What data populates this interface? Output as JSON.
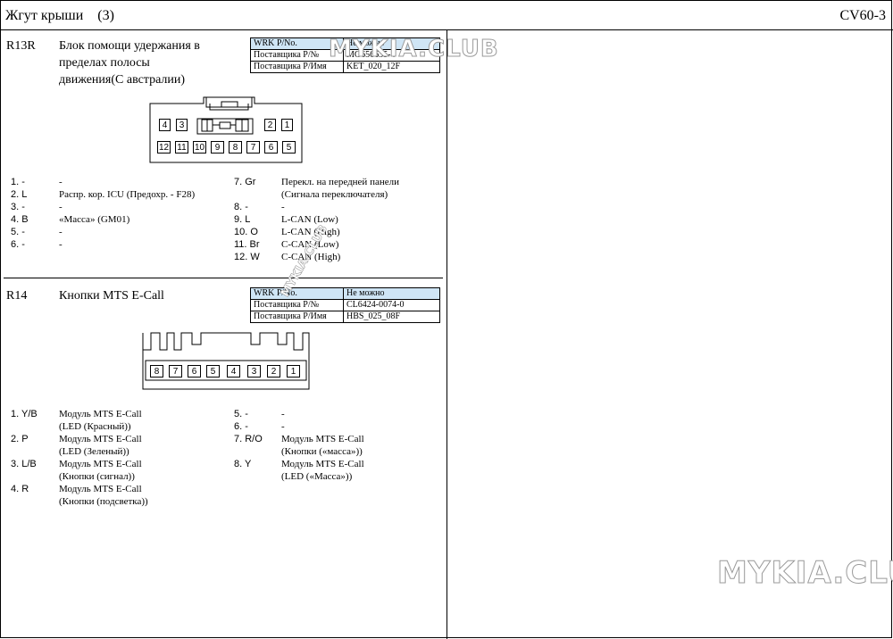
{
  "header": {
    "title": "Жгут крыши    (3)",
    "code": "CV60-3"
  },
  "sections": [
    {
      "id": "R13R",
      "name": "Блок помощи удержания в пределах полосы движения(С австралии)",
      "table": [
        {
          "label": "WRK P/No.",
          "value": "Не можно"
        },
        {
          "label": "Поставщика P/№",
          "value": "MG656635-4"
        },
        {
          "label": "Поставщика P/Имя",
          "value": "KET_020_12F"
        }
      ],
      "connector_top_pins": [
        "4",
        "3",
        "2",
        "1"
      ],
      "connector_bottom_pins": [
        "12",
        "11",
        "10",
        "9",
        "8",
        "7",
        "6",
        "5"
      ],
      "pins_left": [
        {
          "num": "1. -",
          "desc": "-"
        },
        {
          "num": "2. L",
          "desc": "Распр. кор. ICU (Предохр. - F28)"
        },
        {
          "num": "3. -",
          "desc": "-"
        },
        {
          "num": "4. B",
          "desc": "«Масса» (GM01)"
        },
        {
          "num": "5. -",
          "desc": "-"
        },
        {
          "num": "6. -",
          "desc": "-"
        }
      ],
      "pins_right": [
        {
          "num": "7. Gr",
          "desc": "Перекл. на передней панели"
        },
        {
          "num": "",
          "desc": "(Сигнала переключателя)"
        },
        {
          "num": "8. -",
          "desc": "-"
        },
        {
          "num": "9. L",
          "desc": "L-CAN (Low)"
        },
        {
          "num": "10. O",
          "desc": "L-CAN (High)"
        },
        {
          "num": "11. Br",
          "desc": "C-CAN (Low)"
        },
        {
          "num": "12. W",
          "desc": "C-CAN (High)"
        }
      ]
    },
    {
      "id": "R14",
      "name": "Кнопки MTS E-Call",
      "table": [
        {
          "label": "WRK P/No.",
          "value": "Не можно"
        },
        {
          "label": "Поставщика P/№",
          "value": "CL6424-0074-0"
        },
        {
          "label": "Поставщика P/Имя",
          "value": "HBS_025_08F"
        }
      ],
      "connector_pins": [
        "8",
        "7",
        "6",
        "5",
        "4",
        "3",
        "2",
        "1"
      ],
      "pins_left": [
        {
          "num": "1. Y/B",
          "desc": "Модуль MTS E-Call"
        },
        {
          "num": "",
          "desc": "(LED (Красный))"
        },
        {
          "num": "2. P",
          "desc": "Модуль MTS E-Call"
        },
        {
          "num": "",
          "desc": "(LED (Зеленый))"
        },
        {
          "num": "3. L/B",
          "desc": "Модуль MTS E-Call"
        },
        {
          "num": "",
          "desc": "(Кнопки (сигнал))"
        },
        {
          "num": "4. R",
          "desc": "Модуль MTS E-Call"
        },
        {
          "num": "",
          "desc": "(Кнопки (подсветка))"
        }
      ],
      "pins_right": [
        {
          "num": "5. -",
          "desc": "-"
        },
        {
          "num": "6. -",
          "desc": "-"
        },
        {
          "num": "7. R/O",
          "desc": "Модуль MTS E-Call"
        },
        {
          "num": "",
          "desc": "(Кнопки («масса»))"
        },
        {
          "num": "8. Y",
          "desc": "Модуль MTS E-Call"
        },
        {
          "num": "",
          "desc": "(LED («Масса»))"
        }
      ]
    }
  ],
  "watermarks": [
    "MYKIA.CLUB",
    "MYKIA.CLUB",
    "MYKIA.CLUB"
  ]
}
